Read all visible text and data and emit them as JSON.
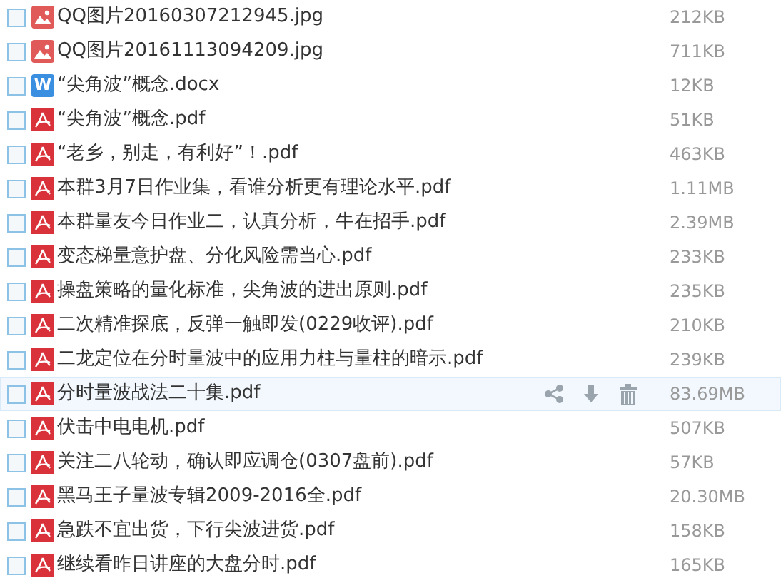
{
  "files": [
    {
      "kind": "image",
      "name": "QQ图片20160307212945.jpg",
      "size": "212KB",
      "checked": false,
      "hovered": false
    },
    {
      "kind": "image",
      "name": "QQ图片20161113094209.jpg",
      "size": "711KB",
      "checked": false,
      "hovered": false
    },
    {
      "kind": "word",
      "icon_text": "W",
      "name": "“尖角波”概念.docx",
      "size": "12KB",
      "checked": false,
      "hovered": false
    },
    {
      "kind": "pdf",
      "name": "“尖角波”概念.pdf",
      "size": "51KB",
      "checked": false,
      "hovered": false
    },
    {
      "kind": "pdf",
      "name": "“老乡，别走，有利好”！.pdf",
      "size": "463KB",
      "checked": false,
      "hovered": false
    },
    {
      "kind": "pdf",
      "name": "本群3月7日作业集，看谁分析更有理论水平.pdf",
      "size": "1.11MB",
      "checked": false,
      "hovered": false
    },
    {
      "kind": "pdf",
      "name": "本群量友今日作业二，认真分析，牛在招手.pdf",
      "size": "2.39MB",
      "checked": false,
      "hovered": false
    },
    {
      "kind": "pdf",
      "name": "变态梯量意护盘、分化风险需当心.pdf",
      "size": "233KB",
      "checked": false,
      "hovered": false
    },
    {
      "kind": "pdf",
      "name": "操盘策略的量化标准，尖角波的进出原则.pdf",
      "size": "235KB",
      "checked": false,
      "hovered": false
    },
    {
      "kind": "pdf",
      "name": "二次精准探底，反弹一触即发(0229收评).pdf",
      "size": "210KB",
      "checked": false,
      "hovered": false
    },
    {
      "kind": "pdf",
      "name": "二龙定位在分时量波中的应用力柱与量柱的暗示.pdf",
      "size": "239KB",
      "checked": false,
      "hovered": false
    },
    {
      "kind": "pdf",
      "name": "分时量波战法二十集.pdf",
      "size": "83.69MB",
      "checked": false,
      "hovered": true
    },
    {
      "kind": "pdf",
      "name": "伏击中电电机.pdf",
      "size": "507KB",
      "checked": false,
      "hovered": false
    },
    {
      "kind": "pdf",
      "name": "关注二八轮动，确认即应调仓(0307盘前).pdf",
      "size": "57KB",
      "checked": false,
      "hovered": false
    },
    {
      "kind": "pdf",
      "name": "黑马王子量波专辑2009-2016全.pdf",
      "size": "20.30MB",
      "checked": false,
      "hovered": false
    },
    {
      "kind": "pdf",
      "name": "急跌不宜出货，下行尖波进货.pdf",
      "size": "158KB",
      "checked": false,
      "hovered": false
    },
    {
      "kind": "pdf",
      "name": "继续看昨日讲座的大盘分时.pdf",
      "size": "165KB",
      "checked": false,
      "hovered": false
    }
  ]
}
